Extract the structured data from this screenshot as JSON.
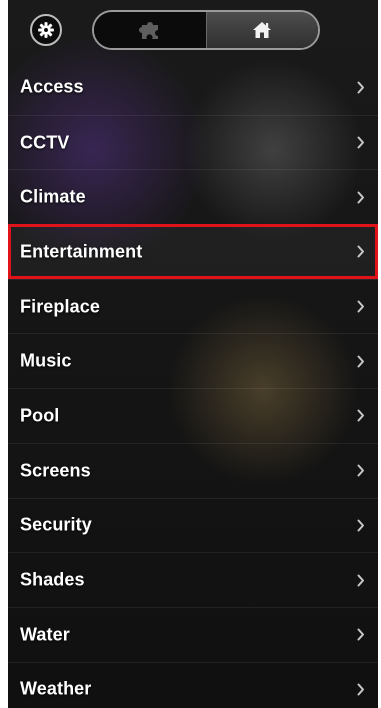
{
  "toolbar": {
    "settings_icon": "gear-icon",
    "tabs": [
      {
        "icon": "puzzle-icon",
        "selected": false
      },
      {
        "icon": "home-icon",
        "selected": true
      }
    ]
  },
  "menu": {
    "selected_index": 3,
    "chevron_icon": "chevron-right-icon",
    "items": [
      {
        "label": "Access"
      },
      {
        "label": "CCTV"
      },
      {
        "label": "Climate"
      },
      {
        "label": "Entertainment"
      },
      {
        "label": "Fireplace"
      },
      {
        "label": "Music"
      },
      {
        "label": "Pool"
      },
      {
        "label": "Screens"
      },
      {
        "label": "Security"
      },
      {
        "label": "Shades"
      },
      {
        "label": "Water"
      },
      {
        "label": "Weather"
      }
    ]
  },
  "colors": {
    "selection_outline": "#e0131b",
    "text": "#ffffff",
    "chevron": "#c8c8c8"
  }
}
